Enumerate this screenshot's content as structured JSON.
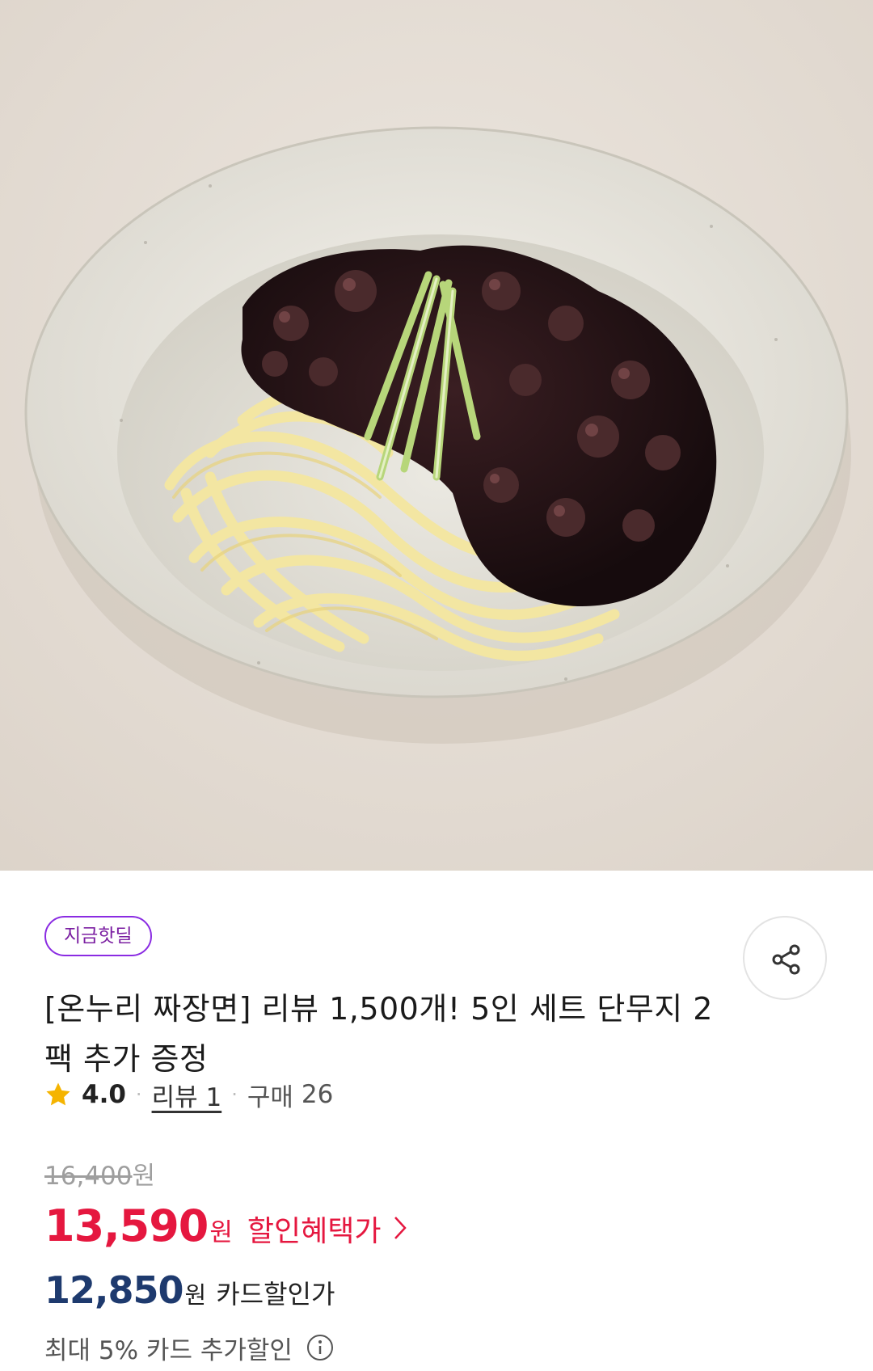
{
  "hero": {
    "image_subject": "jjajangmyeon-bowl"
  },
  "product": {
    "badge": "지금핫딜",
    "title": "[온누리 짜장면] 리뷰 1,500개! 5인 세트 단무지 2팩 추가 증정",
    "rating": "4.0",
    "review_label": "리뷰 1",
    "purchase_label": "구매",
    "purchase_count": "26"
  },
  "price": {
    "original": "16,400",
    "original_unit": "원",
    "sale": "13,590",
    "sale_unit": "원",
    "sale_label": "할인혜택가",
    "card": "12,850",
    "card_unit": "원",
    "card_label": "카드할인가",
    "extra_label": "최대 5% 카드 추가할인"
  },
  "icons": {
    "share": "share-icon",
    "star": "star-icon",
    "chevron": "chevron-right-icon",
    "info": "info-icon"
  },
  "colors": {
    "badge_purple": "#8a2be2",
    "sale_red": "#e5173f",
    "card_navy": "#1e3a6e",
    "star_yellow": "#f5b400"
  }
}
